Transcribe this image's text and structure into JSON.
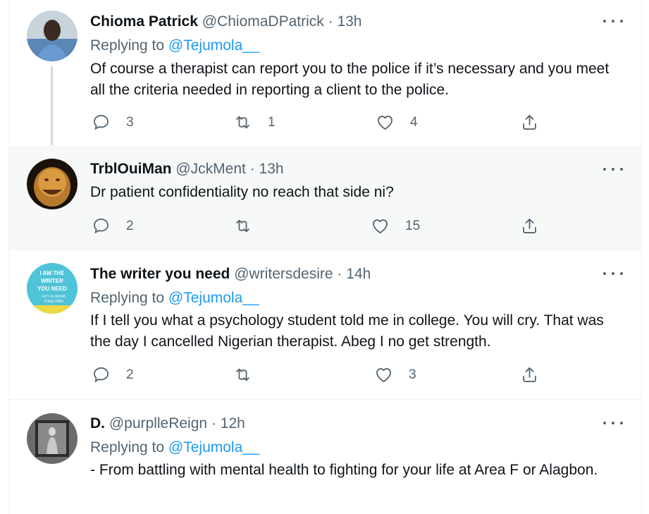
{
  "tweets": [
    {
      "name": "Chioma Patrick",
      "handle": "@ChiomaDPatrick",
      "dot": "·",
      "time": "13h",
      "replying_label": "Replying to",
      "replying_to": "@Tejumola__",
      "text": "Of course a therapist can report you to the police if it’s necessary and you meet all the criteria needed in reporting a client to the police.",
      "replies": "3",
      "retweets": "1",
      "likes": "4"
    },
    {
      "name": "TrblOuiMan",
      "handle": "@JckMent",
      "dot": "·",
      "time": "13h",
      "text": "Dr patient confidentiality no reach that side ni?",
      "replies": "2",
      "retweets": "",
      "likes": "15"
    },
    {
      "name": "The writer you need",
      "handle": "@writersdesire",
      "dot": "·",
      "time": "14h",
      "replying_label": "Replying to",
      "replying_to": "@Tejumola__",
      "text": "If I tell you what a psychology student told me in college. You will cry. That was the day I cancelled Nigerian therapist. Abeg I no get strength.",
      "replies": "2",
      "retweets": "",
      "likes": "3",
      "avatar_text": [
        "I AM THE",
        "WRITER",
        "YOU NEED",
        "LET US WORK",
        "TOGETHER"
      ]
    },
    {
      "name": "D.",
      "handle": "@purplleReign",
      "dot": "·",
      "time": "12h",
      "replying_label": "Replying to",
      "replying_to": "@Tejumola__",
      "text": "- From battling with mental health to fighting for your life at Area F or Alagbon."
    }
  ],
  "colors": {
    "accent": "#1d9bf0",
    "secondary_text": "#536471",
    "highlight_bg": "#f7f9f9",
    "writer_avatar_bg": "#4fc3d8"
  },
  "icons": [
    "reply-icon",
    "retweet-icon",
    "like-icon",
    "share-icon",
    "more-icon"
  ]
}
